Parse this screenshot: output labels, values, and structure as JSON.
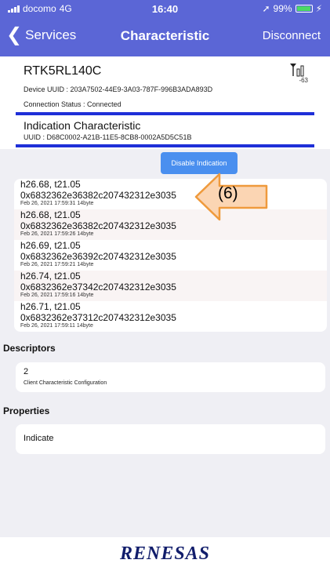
{
  "status_bar": {
    "carrier": "docomo",
    "network": "4G",
    "time": "16:40",
    "battery": "99%"
  },
  "nav": {
    "back_label": "Services",
    "title": "Characteristic",
    "action_label": "Disconnect"
  },
  "device": {
    "name": "RTK5RL140C",
    "rssi": "-63",
    "uuid_line": "Device UUID : 203A7502-44E9-3A03-787F-996B3ADA893D",
    "status_line": "Connection Status :   Connected"
  },
  "characteristic": {
    "name": "Indication Characteristic",
    "uuid_line": "UUID : D68C0002-A21B-11E5-8CB8-0002A5D5C51B"
  },
  "indication_button_label": "Disable Indication",
  "log": [
    {
      "line1": "h26.68, t21.05",
      "line2": "0x6832362e36382c207432312e3035",
      "meta": "Feb 26, 2021 17:59:31   14byte"
    },
    {
      "line1": "h26.68, t21.05",
      "line2": "0x6832362e36382c207432312e3035",
      "meta": "Feb 26, 2021 17:59:26   14byte"
    },
    {
      "line1": "h26.69, t21.05",
      "line2": "0x6832362e36392c207432312e3035",
      "meta": "Feb 26, 2021 17:59:21   14byte"
    },
    {
      "line1": "h26.74, t21.05",
      "line2": "0x6832362e37342c207432312e3035",
      "meta": "Feb 26, 2021 17:59:16   14byte"
    },
    {
      "line1": "h26.71, t21.05",
      "line2": "0x6832362e37312c207432312e3035",
      "meta": "Feb 26, 2021 17:59:11   14byte"
    }
  ],
  "callout_label": "(6)",
  "descriptors": {
    "title": "Descriptors",
    "value": "2",
    "name": "Client Characteristic Configuration"
  },
  "properties": {
    "title": "Properties",
    "value": "Indicate"
  },
  "footer_logo": "RENESAS",
  "colors": {
    "nav_bg": "#5b66d6",
    "rule": "#1e2fd8",
    "button": "#4a8fef",
    "callout_fill": "#fbd5b3",
    "callout_stroke": "#ef9a3c"
  }
}
